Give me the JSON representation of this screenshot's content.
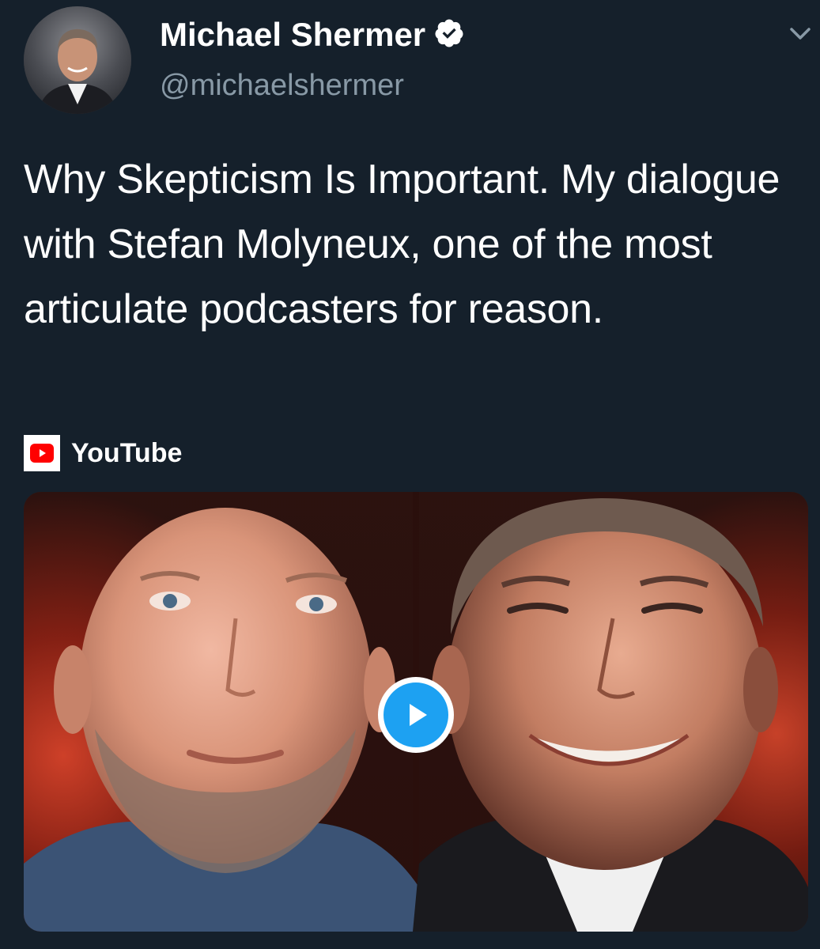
{
  "author": {
    "name": "Michael Shermer",
    "handle": "@michaelshermer",
    "verified": true,
    "avatar": "avatar-photo"
  },
  "tweet": {
    "text": "Why Skepticism Is Important. My dialogue with Stefan Molyneux, one of the most articulate podcasters for reason."
  },
  "source": {
    "name": "YouTube",
    "icon": "youtube-icon"
  },
  "media": {
    "type": "video-thumbnail",
    "play_icon": "play-icon"
  },
  "icons": {
    "verified": "verified-badge-icon",
    "menu": "chevron-down-icon"
  },
  "colors": {
    "background": "#15202b",
    "text_primary": "#ffffff",
    "text_secondary": "#8899a6",
    "accent": "#1da1f2",
    "youtube_red": "#ff0000"
  }
}
